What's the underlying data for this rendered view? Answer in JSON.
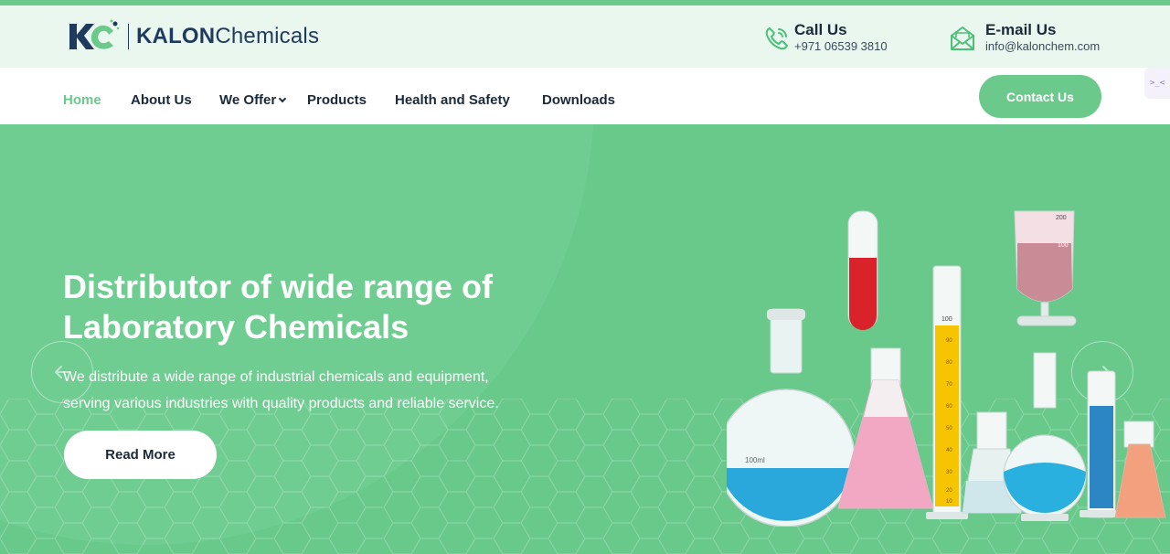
{
  "brand": {
    "logo_text_bold": "KALON",
    "logo_text_light": "Chemicals",
    "logo_monogram": "KC",
    "primary_color": "#6cc98c",
    "dark_color": "#1e3a5f"
  },
  "header": {
    "call": {
      "title": "Call Us",
      "value": "+971 06539 3810",
      "icon": "phone-icon"
    },
    "mail": {
      "title": "E-mail Us",
      "value": "info@kalonchem.com",
      "icon": "mail-icon"
    }
  },
  "nav": {
    "items": [
      {
        "label": "Home",
        "active": true
      },
      {
        "label": "About Us",
        "active": false
      },
      {
        "label": "We Offer",
        "active": false,
        "has_dropdown": true
      },
      {
        "label": "Products",
        "active": false
      },
      {
        "label": "Health and Safety",
        "active": false
      },
      {
        "label": "Downloads",
        "active": false
      }
    ],
    "cta_label": "Contact Us"
  },
  "side_widget": {
    "text": ">_<"
  },
  "hero": {
    "title_line1": "Distributor of wide range of",
    "title_line2": "Laboratory Chemicals",
    "subtitle_line1": "We distribute a wide range of industrial chemicals and equipment,",
    "subtitle_line2": "serving various industries with quality products and reliable service.",
    "button_label": "Read More",
    "prev_icon": "arrow-left-icon",
    "next_icon": "arrow-right-icon",
    "bg_color": "#68c98b"
  },
  "glassware": {
    "flask_label": "100ml",
    "cylinder_top": "100",
    "cylinder_ticks": [
      "90",
      "80",
      "70",
      "60",
      "50",
      "40",
      "30",
      "20",
      "10"
    ],
    "funnel_labels": [
      "200",
      "100"
    ]
  }
}
